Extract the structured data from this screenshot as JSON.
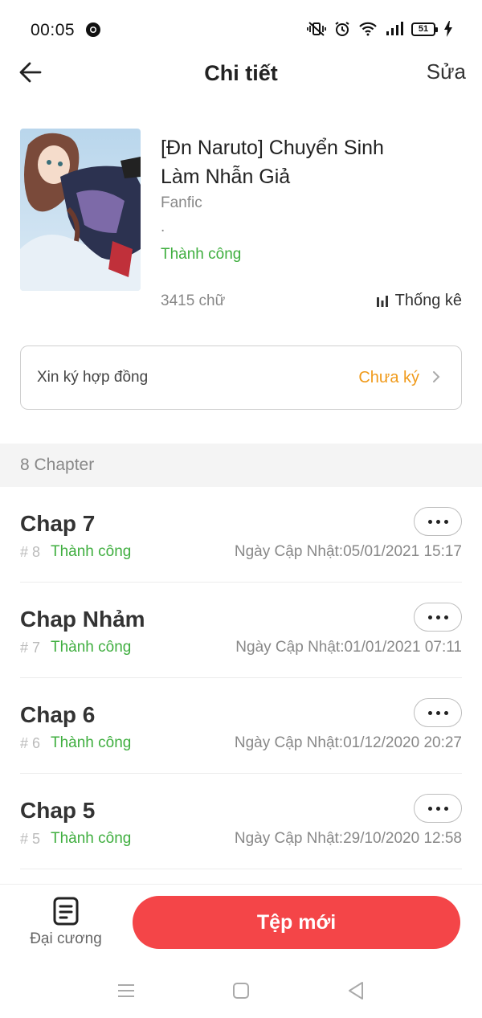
{
  "status_bar": {
    "time": "00:05",
    "battery": "51"
  },
  "header": {
    "title": "Chi tiết",
    "edit_label": "Sửa"
  },
  "book": {
    "title": "[Đn Naruto] Chuyển Sinh Làm Nhẫn Giả",
    "genre": "Fanfic",
    "dot": ".",
    "status": "Thành công",
    "word_count": "3415 chữ",
    "stats_label": "Thống kê"
  },
  "contract": {
    "label": "Xin ký hợp đồng",
    "status": "Chưa ký"
  },
  "chapters_section": {
    "label": "8 Chapter"
  },
  "chapters": [
    {
      "title": "Chap 7",
      "number": "# 8",
      "status": "Thành công",
      "updated": "Ngày Cập Nhật:05/01/2021 15:17"
    },
    {
      "title": "Chap Nhảm",
      "number": "# 7",
      "status": "Thành công",
      "updated": "Ngày Cập Nhật:01/01/2021 07:11"
    },
    {
      "title": "Chap 6",
      "number": "# 6",
      "status": "Thành công",
      "updated": "Ngày Cập Nhật:01/12/2020 20:27"
    },
    {
      "title": "Chap 5",
      "number": "# 5",
      "status": "Thành công",
      "updated": "Ngày Cập Nhật:29/10/2020 12:58"
    }
  ],
  "bottom": {
    "outline_label": "Đại cương",
    "new_button_label": "Tệp mới"
  },
  "colors": {
    "success_green": "#3fae3f",
    "contract_orange": "#f09a1a",
    "primary_red": "#f44548"
  }
}
